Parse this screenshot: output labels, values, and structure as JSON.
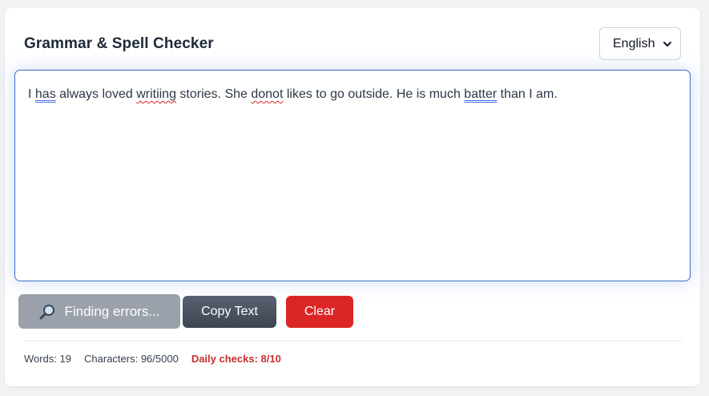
{
  "header": {
    "title": "Grammar & Spell Checker",
    "language": "English"
  },
  "editor": {
    "segments": [
      {
        "text": "I ",
        "error": "none"
      },
      {
        "text": "has",
        "error": "grammar"
      },
      {
        "text": " always loved ",
        "error": "none"
      },
      {
        "text": "writiing",
        "error": "spelling"
      },
      {
        "text": " stories. She ",
        "error": "none"
      },
      {
        "text": "donot",
        "error": "spelling"
      },
      {
        "text": " likes to go outside. He is much ",
        "error": "none"
      },
      {
        "text": "batter",
        "error": "grammar"
      },
      {
        "text": " than I am.",
        "error": "none"
      }
    ]
  },
  "actions": {
    "find_label": "Finding errors...",
    "find_icon": "magnifier-icon",
    "copy_label": "Copy Text",
    "clear_label": "Clear"
  },
  "stats": {
    "words": "Words: 19",
    "characters": "Characters: 96/5000",
    "daily_checks": "Daily checks: 8/10"
  },
  "colors": {
    "accent_border": "#3b6fc9",
    "spelling_underline": "#e02424",
    "grammar_underline": "#4c6fe0",
    "clear_button": "#dc2626",
    "limit_text": "#c53030"
  }
}
